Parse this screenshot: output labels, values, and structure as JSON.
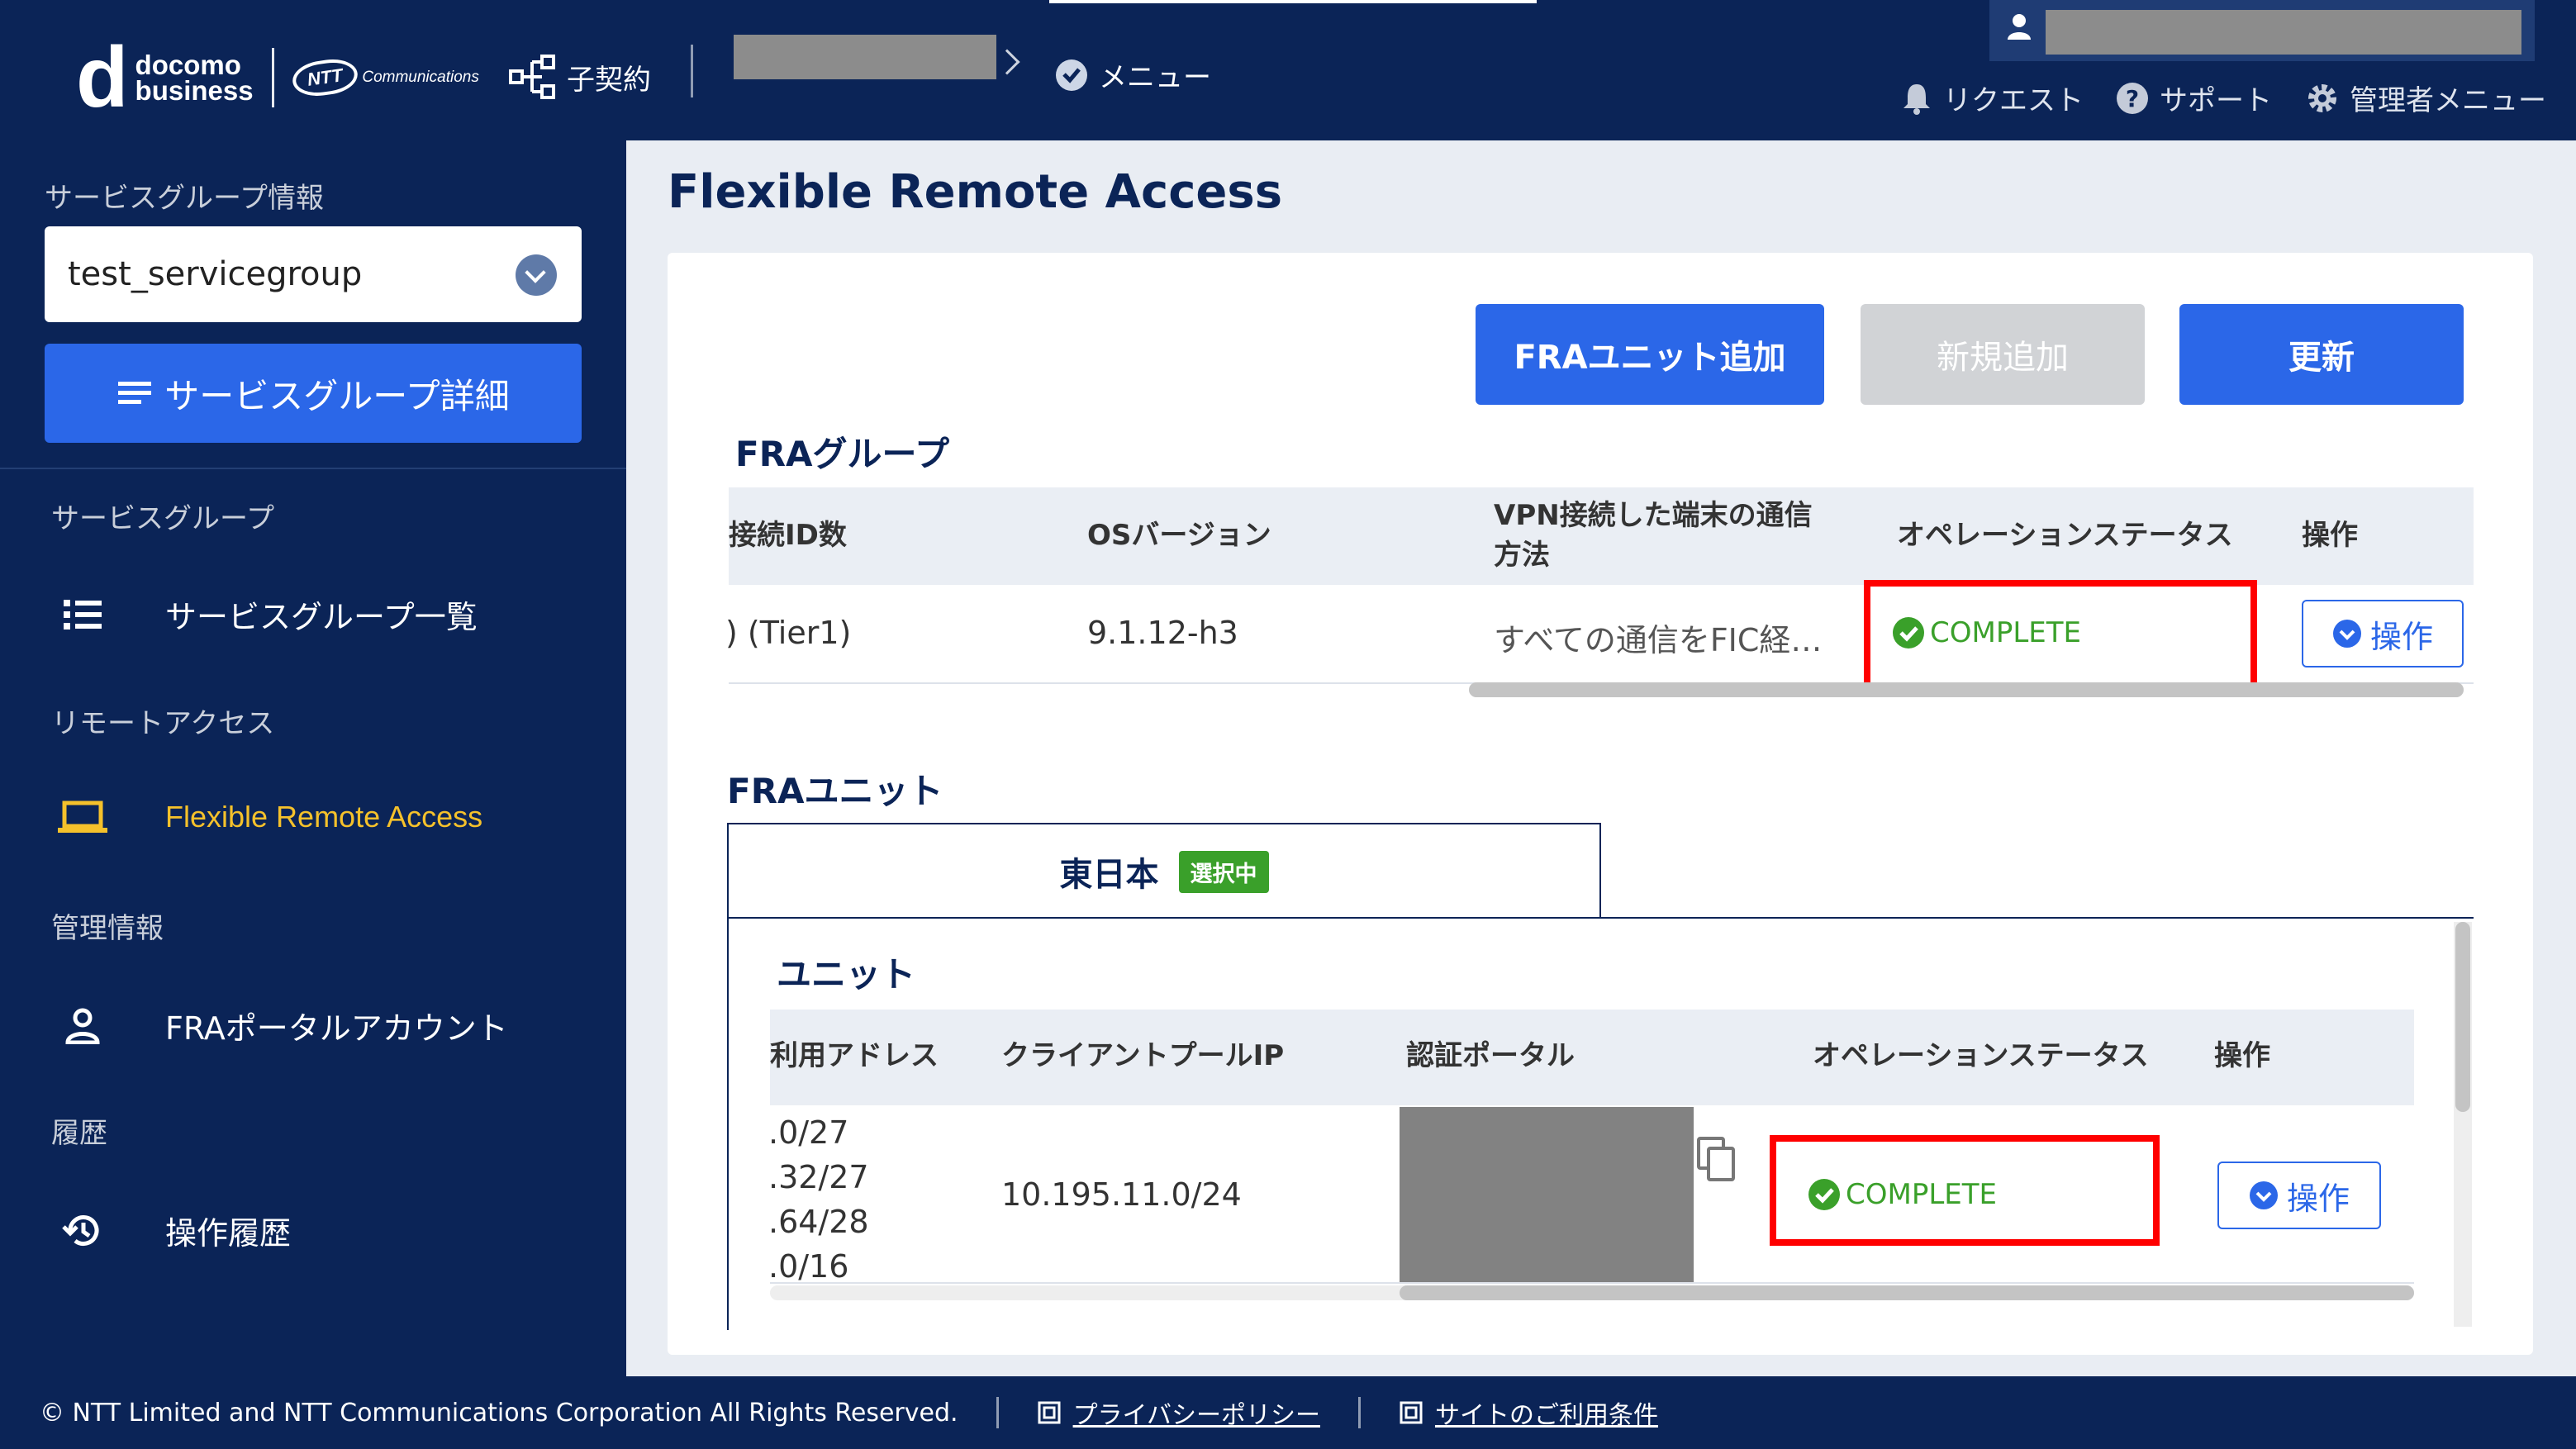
{
  "header": {
    "logo_brand_line1": "docomo",
    "logo_brand_line2": "business",
    "ntt_logo": "NTT",
    "ntt_sub": "Communications",
    "contract_label": "子契約",
    "menu_label": "メニュー",
    "request_label": "リクエスト",
    "support_label": "サポート",
    "admin_label": "管理者メニュー"
  },
  "sidebar": {
    "sg_info_label": "サービスグループ情報",
    "sg_select_value": "test_servicegroup",
    "sg_detail_button": "サービスグループ詳細",
    "sections": [
      {
        "label": "サービスグループ",
        "items": [
          {
            "label": "サービスグループ一覧",
            "icon": "list-icon"
          }
        ]
      },
      {
        "label": "リモートアクセス",
        "items": [
          {
            "label": "Flexible Remote Access",
            "icon": "laptop-icon",
            "active": true
          }
        ]
      },
      {
        "label": "管理情報",
        "items": [
          {
            "label": "FRAポータルアカウント",
            "icon": "person-icon"
          }
        ]
      },
      {
        "label": "履歴",
        "items": [
          {
            "label": "操作履歴",
            "icon": "history-icon"
          }
        ]
      }
    ]
  },
  "main": {
    "page_title": "Flexible Remote Access",
    "buttons": {
      "add_unit": "FRAユニット追加",
      "add_new": "新規追加",
      "refresh": "更新"
    },
    "fra_group": {
      "title": "FRAグループ",
      "columns": [
        "接続ID数",
        "OSバージョン",
        "VPN接続した端末の通信方法",
        "オペレーションステータス",
        "操作"
      ],
      "vpn_col_line1": "VPN接続した端末の通信",
      "vpn_col_line2": "方法",
      "row": {
        "conn_id": ") (Tier1)",
        "os_version": "9.1.12-h3",
        "vpn_method": "すべての通信をFIC経…",
        "status": "COMPLETE",
        "action": "操作"
      }
    },
    "fra_unit": {
      "title": "FRAユニット",
      "tab_label": "東日本",
      "tab_badge": "選択中",
      "unit_title": "ユニット",
      "columns": [
        "利用アドレス",
        "クライアントプールIP",
        "認証ポータル",
        "オペレーションステータス",
        "操作"
      ],
      "row": {
        "addresses": [
          ".0/27",
          ".32/27",
          ".64/28",
          ".0/16"
        ],
        "client_pool_ip": "10.195.11.0/24",
        "status": "COMPLETE",
        "action": "操作"
      }
    }
  },
  "footer": {
    "copyright": "© NTT Limited and NTT Communications Corporation All Rights Reserved.",
    "privacy": "プライバシーポリシー",
    "terms": "サイトのご利用条件"
  },
  "colors": {
    "navy": "#0b2457",
    "primary": "#2b67e8",
    "active_nav": "#f5c12b",
    "status_green": "#3aa02a",
    "highlight_red": "#ff0000"
  }
}
